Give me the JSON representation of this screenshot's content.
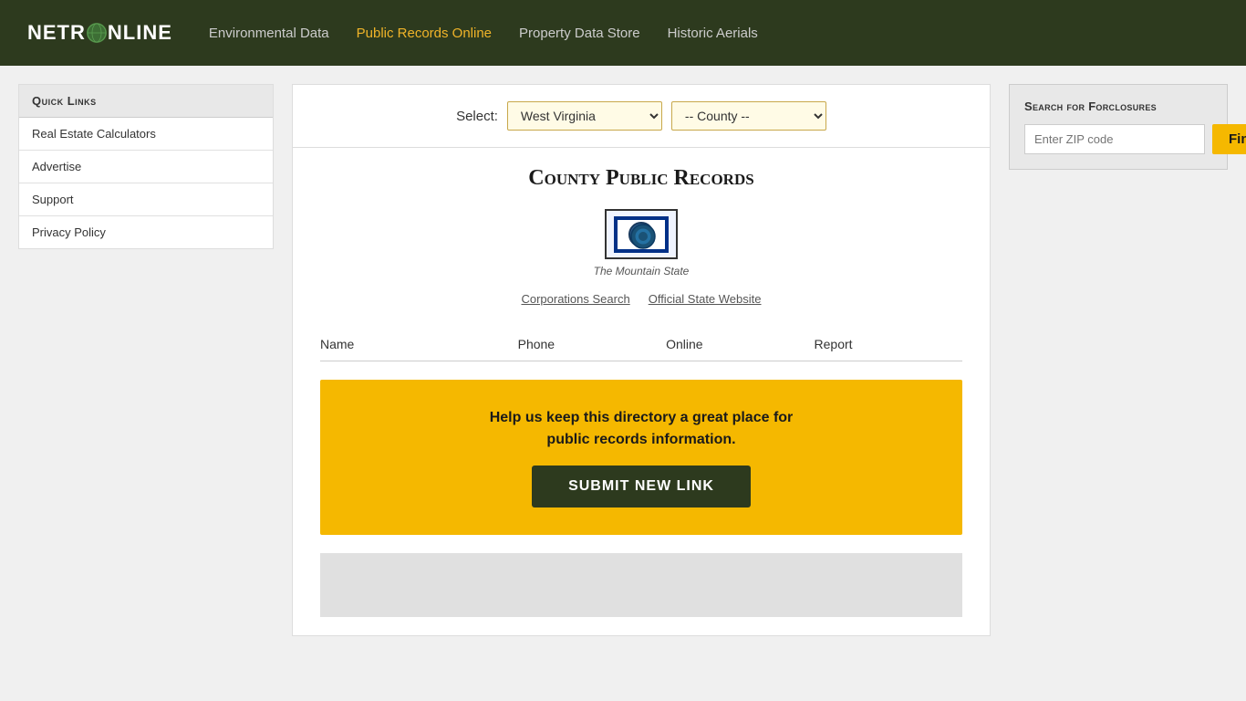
{
  "header": {
    "logo": "NETR●NLINE",
    "logo_text_before": "NETR",
    "logo_text_after": "NLINE",
    "nav": [
      {
        "label": "Environmental Data",
        "active": false
      },
      {
        "label": "Public Records Online",
        "active": true
      },
      {
        "label": "Property Data Store",
        "active": false
      },
      {
        "label": "Historic Aerials",
        "active": false
      }
    ]
  },
  "sidebar": {
    "quick_links_title": "Quick Links",
    "items": [
      {
        "label": "Real Estate Calculators"
      },
      {
        "label": "Advertise"
      },
      {
        "label": "Support"
      },
      {
        "label": "Privacy Policy"
      }
    ]
  },
  "select_bar": {
    "label": "Select:",
    "state_value": "West Virginia",
    "county_placeholder": "-- County --",
    "state_options": [
      "West Virginia"
    ],
    "county_options": [
      "-- County --"
    ]
  },
  "main": {
    "page_title": "County Public Records",
    "state_nickname": "The Mountain State",
    "links": [
      {
        "label": "Corporations Search"
      },
      {
        "label": "Official State Website"
      }
    ],
    "table_headers": [
      "Name",
      "Phone",
      "Online",
      "Report"
    ],
    "cta": {
      "text_line1": "Help us keep this directory a great place for",
      "text_line2": "public records information.",
      "button_label": "SUBMIT NEW LINK"
    }
  },
  "right_sidebar": {
    "foreclosure_title": "Search for Forclosures",
    "zip_placeholder": "Enter ZIP code",
    "find_button": "Find!"
  }
}
